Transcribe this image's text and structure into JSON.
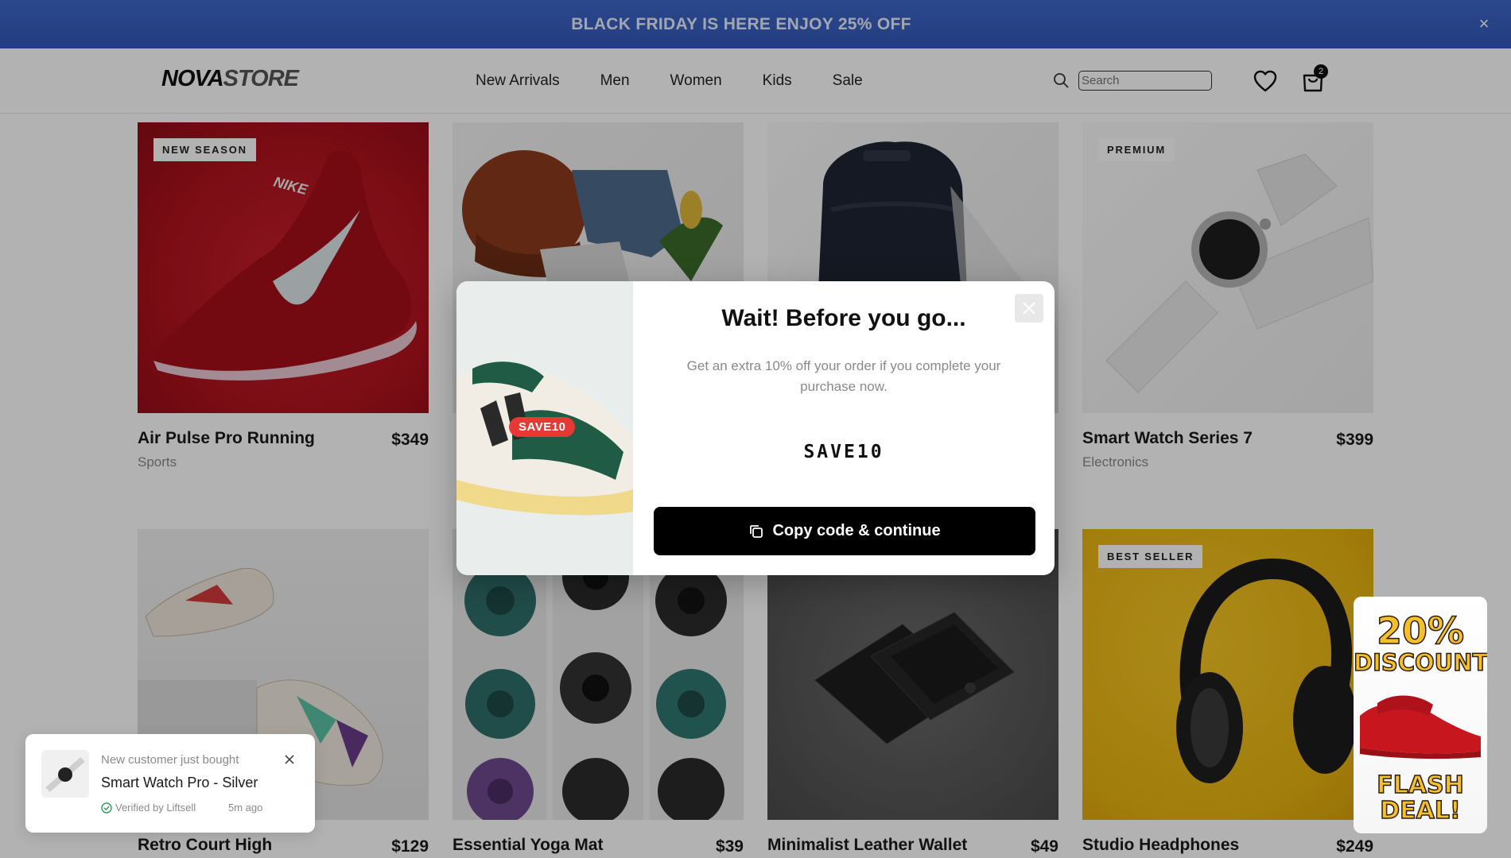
{
  "banner": {
    "text": "BLACK FRIDAY IS HERE ENJOY 25% OFF",
    "close_label": "×"
  },
  "header": {
    "logo_primary": "NOVA",
    "logo_secondary": "STORE",
    "nav": [
      "New Arrivals",
      "Men",
      "Women",
      "Kids",
      "Sale"
    ],
    "search_placeholder": "Search",
    "cart_count": "2"
  },
  "products": [
    {
      "name": "Air Pulse Pro Running",
      "price": "$349",
      "category": "Sports",
      "badge": "NEW SEASON"
    },
    {
      "name": "",
      "price": "",
      "category": "",
      "badge": ""
    },
    {
      "name": "",
      "price": "",
      "category": "",
      "badge": ""
    },
    {
      "name": "Smart Watch Series 7",
      "price": "$399",
      "category": "Electronics",
      "badge": "PREMIUM"
    },
    {
      "name": "Retro Court High",
      "price": "$129",
      "category": "",
      "badge": ""
    },
    {
      "name": "Essential Yoga Mat",
      "price": "$39",
      "category": "",
      "badge": ""
    },
    {
      "name": "Minimalist Leather Wallet",
      "price": "$49",
      "category": "",
      "badge": ""
    },
    {
      "name": "Studio Headphones",
      "price": "$249",
      "category": "",
      "badge": "BEST SELLER"
    }
  ],
  "modal": {
    "title": "Wait! Before you go...",
    "subtitle": "Get an extra 10% off your order if you complete your purchase now.",
    "image_tag": "SAVE10",
    "code": "SAVE10",
    "button_label": "Copy code & continue"
  },
  "toast": {
    "overline": "New customer just bought",
    "product": "Smart Watch Pro - Silver",
    "verified": "Verified by Liftsell",
    "time": "5m ago"
  },
  "promo": {
    "line1": "20%",
    "line2": "DISCOUNT",
    "line3": "FLASH",
    "line4": "DEAL!"
  },
  "colors": {
    "banner": "#3e67c8",
    "accent_red": "#e53935",
    "promo_yellow": "#f6c02a"
  }
}
